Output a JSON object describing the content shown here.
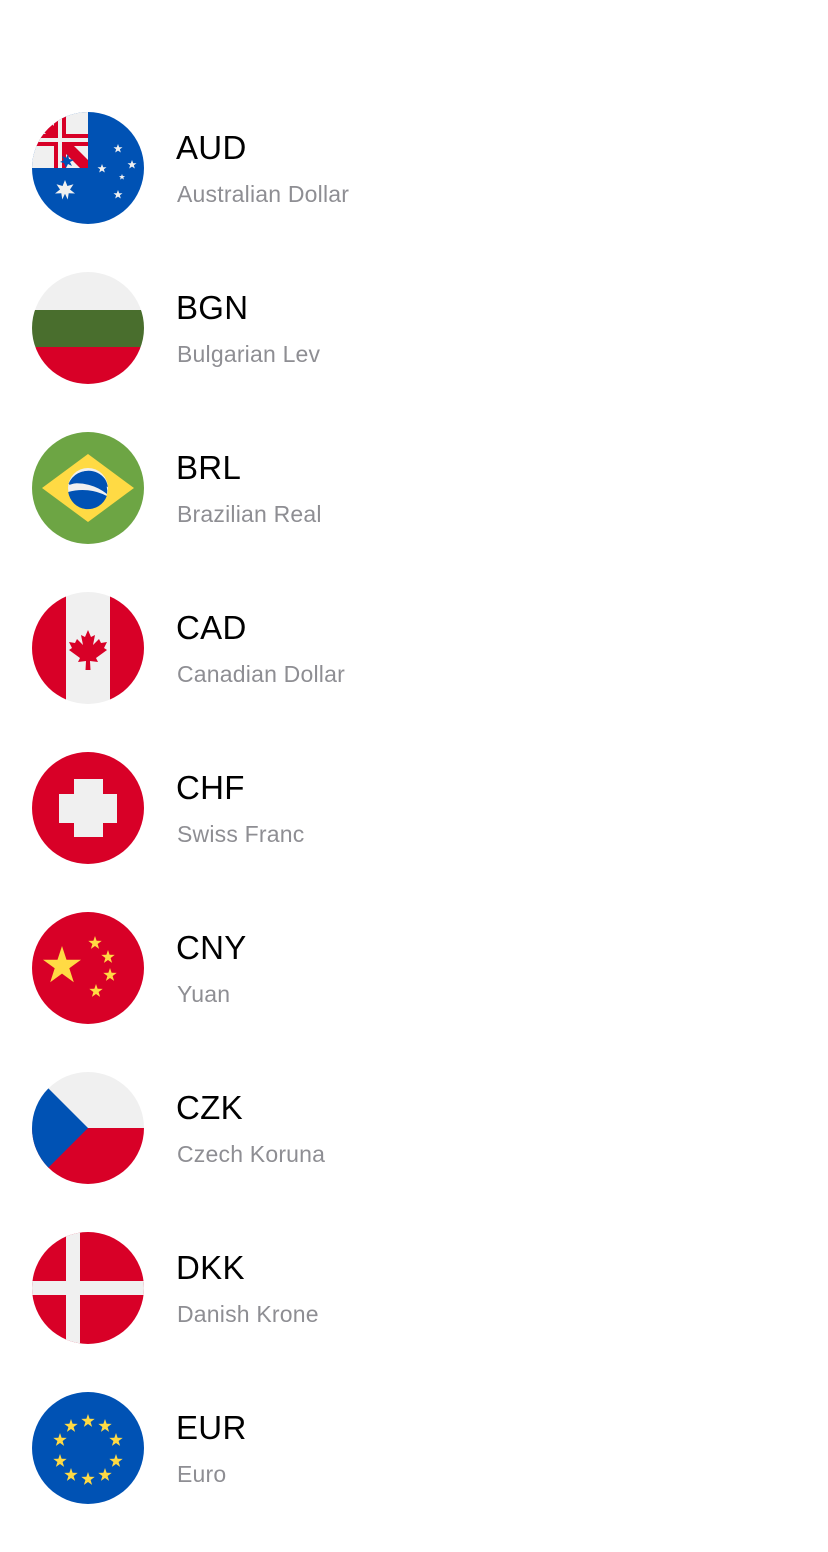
{
  "currencies": [
    {
      "code": "AUD",
      "name": "Australian Dollar",
      "flag_icon": "australia-flag-icon"
    },
    {
      "code": "BGN",
      "name": "Bulgarian Lev",
      "flag_icon": "bulgaria-flag-icon"
    },
    {
      "code": "BRL",
      "name": "Brazilian Real",
      "flag_icon": "brazil-flag-icon"
    },
    {
      "code": "CAD",
      "name": "Canadian Dollar",
      "flag_icon": "canada-flag-icon"
    },
    {
      "code": "CHF",
      "name": "Swiss Franc",
      "flag_icon": "switzerland-flag-icon"
    },
    {
      "code": "CNY",
      "name": "Yuan",
      "flag_icon": "china-flag-icon"
    },
    {
      "code": "CZK",
      "name": "Czech Koruna",
      "flag_icon": "czech-republic-flag-icon"
    },
    {
      "code": "DKK",
      "name": "Danish Krone",
      "flag_icon": "denmark-flag-icon"
    },
    {
      "code": "EUR",
      "name": "Euro",
      "flag_icon": "european-union-flag-icon"
    }
  ],
  "colors": {
    "code_text": "#000000",
    "name_text": "#8e8e93",
    "background": "#ffffff"
  }
}
